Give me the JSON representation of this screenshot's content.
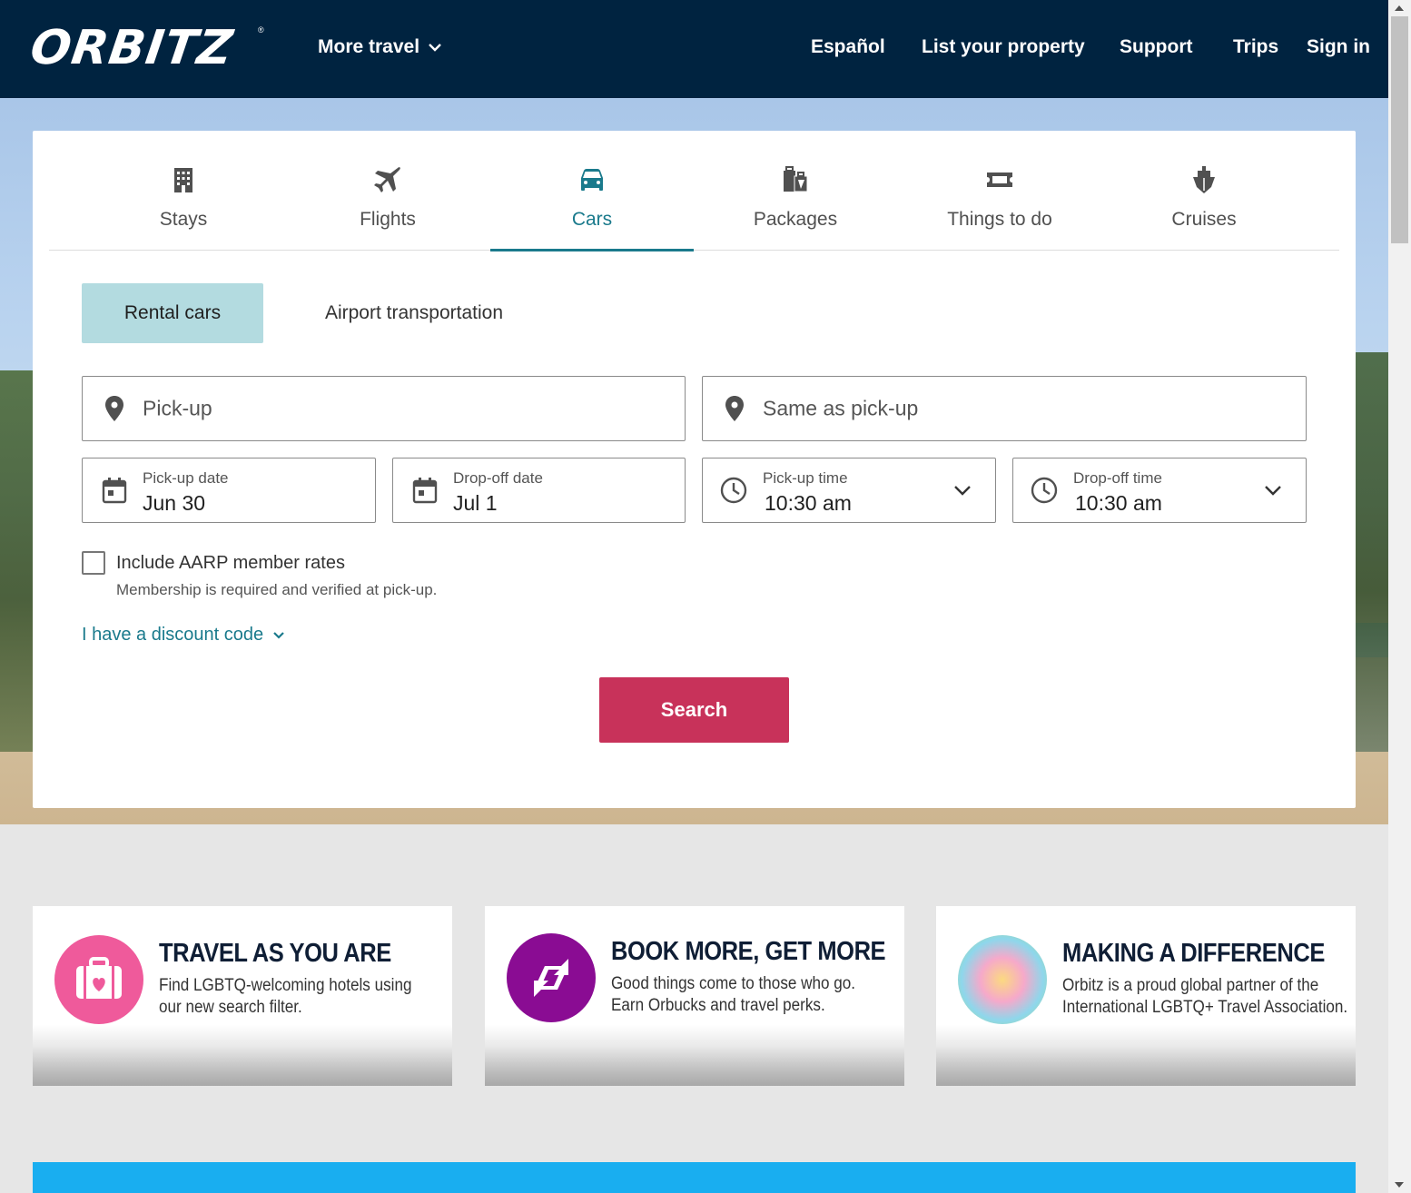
{
  "header": {
    "logo": "ORBITZ",
    "more_travel": "More travel",
    "nav": [
      "Español",
      "List your property",
      "Support",
      "Trips",
      "Sign in"
    ]
  },
  "tabs": [
    {
      "label": "Stays",
      "icon": "building-icon"
    },
    {
      "label": "Flights",
      "icon": "airplane-icon"
    },
    {
      "label": "Cars",
      "icon": "car-icon"
    },
    {
      "label": "Packages",
      "icon": "luggage-icon"
    },
    {
      "label": "Things to do",
      "icon": "ticket-icon"
    },
    {
      "label": "Cruises",
      "icon": "ship-icon"
    }
  ],
  "active_tab": "Cars",
  "subtabs": {
    "rental": "Rental cars",
    "airport": "Airport transportation"
  },
  "form": {
    "pickup_placeholder": "Pick-up",
    "dropoff_placeholder": "Same as pick-up",
    "pickup_date_label": "Pick-up date",
    "pickup_date": "Jun 30",
    "dropoff_date_label": "Drop-off date",
    "dropoff_date": "Jul 1",
    "pickup_time_label": "Pick-up time",
    "pickup_time": "10:30 am",
    "dropoff_time_label": "Drop-off time",
    "dropoff_time": "10:30 am",
    "aarp_label": "Include AARP member rates",
    "aarp_note": "Membership is required and verified at pick-up.",
    "discount": "I have a discount code",
    "search": "Search"
  },
  "promos": [
    {
      "title": "TRAVEL AS YOU ARE",
      "line1": "Find LGBTQ-welcoming hotels using",
      "line2": "our new search filter.",
      "color": "#ef5a9b"
    },
    {
      "title": "BOOK MORE, GET MORE",
      "line1": "Good things come to those who go.",
      "line2": "Earn Orbucks and travel perks.",
      "color": "#8a0c93"
    },
    {
      "title": "MAKING A DIFFERENCE",
      "line1": "Orbitz is a proud global partner of the",
      "line2": "International LGBTQ+ Travel Association.",
      "color": "#e8a8c8"
    }
  ],
  "colors": {
    "header": "#002340",
    "accent": "#1a7a8c",
    "search": "#c8325a",
    "subtab_active": "#b3dbe0"
  }
}
